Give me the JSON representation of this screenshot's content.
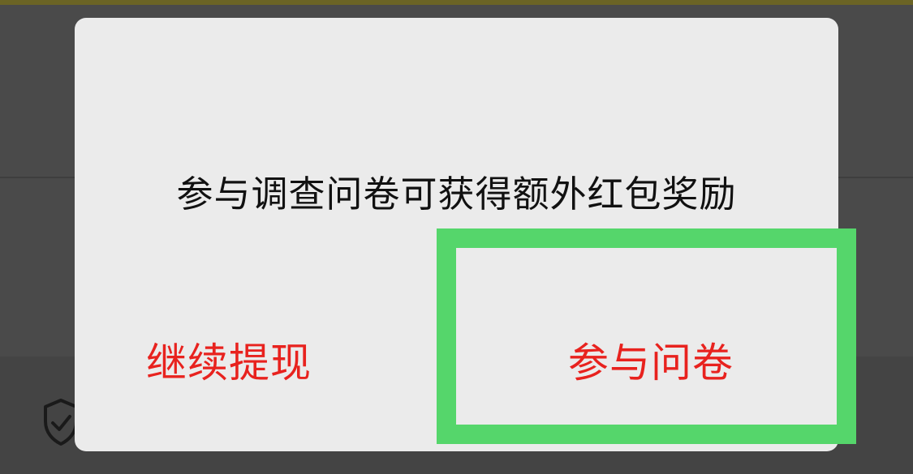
{
  "dialog": {
    "message": "参与调查问卷可获得额外红包奖励",
    "continue_label": "继续提现",
    "survey_label": "参与问卷"
  },
  "highlight": {
    "color": "#55d66b",
    "target": "survey-button"
  },
  "colors": {
    "overlay": "#4a4a4a",
    "dialog_bg": "#ebebeb",
    "message_text": "#111111",
    "button_text": "#e8221e"
  },
  "icons": [
    "shield-check-icon",
    "chevron-right-icon"
  ]
}
